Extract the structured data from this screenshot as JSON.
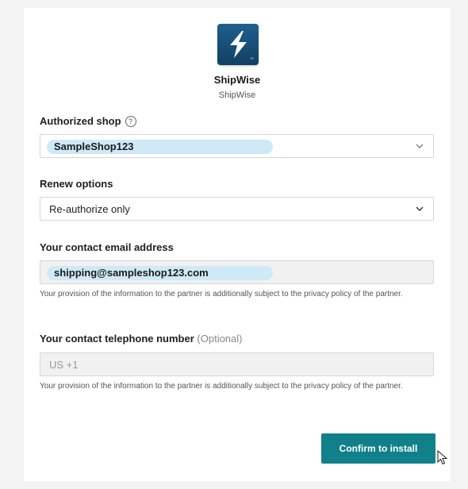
{
  "app": {
    "name": "ShipWise",
    "subtitle": "ShipWise",
    "logo_icon": "lightning-bolt-logo",
    "brand_color": "#1f5f8e"
  },
  "authorized_shop": {
    "label": "Authorized shop",
    "value": "SampleShop123"
  },
  "renew_options": {
    "label": "Renew options",
    "value": "Re-authorize only"
  },
  "contact_email": {
    "label": "Your contact email address",
    "value": "shipping@sampleshop123.com",
    "note": "Your provision of the information to the partner is additionally subject to the privacy policy of the partner."
  },
  "contact_phone": {
    "label": "Your contact telephone number",
    "optional": "(Optional)",
    "placeholder": "US +1",
    "note": "Your provision of the information to the partner is additionally subject to the privacy policy of the partner."
  },
  "confirm_button": {
    "label": "Confirm to install",
    "color": "#10808a"
  }
}
